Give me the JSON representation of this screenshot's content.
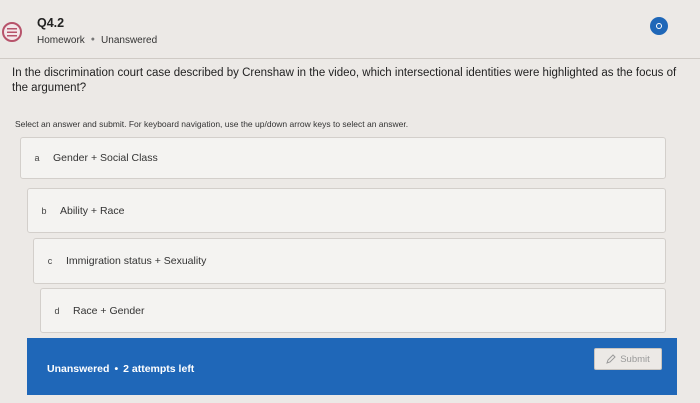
{
  "header": {
    "question_number": "Q4.2",
    "category": "Homework",
    "status": "Unanswered",
    "icon": "list-icon",
    "status_indicator_icon": "unanswered-dot-icon"
  },
  "question": {
    "text": "In the discrimination court case described by Crenshaw in the video, which intersectional identities were highlighted as the focus of the argument?",
    "instructions": "Select an answer and submit. For keyboard navigation, use the up/down arrow keys to select an answer."
  },
  "choices": [
    {
      "letter": "a",
      "label": "Gender + Social Class"
    },
    {
      "letter": "b",
      "label": "Ability + Race"
    },
    {
      "letter": "c",
      "label": "Immigration status + Sexuality"
    },
    {
      "letter": "d",
      "label": "Race + Gender"
    }
  ],
  "footer": {
    "status": "Unanswered",
    "separator": "•",
    "attempts": "2 attempts left",
    "submit_label": "Submit",
    "submit_icon": "pencil-icon"
  },
  "colors": {
    "accent": "#1f67b8",
    "icon_border": "#b7536b",
    "background": "#ece9e6"
  }
}
